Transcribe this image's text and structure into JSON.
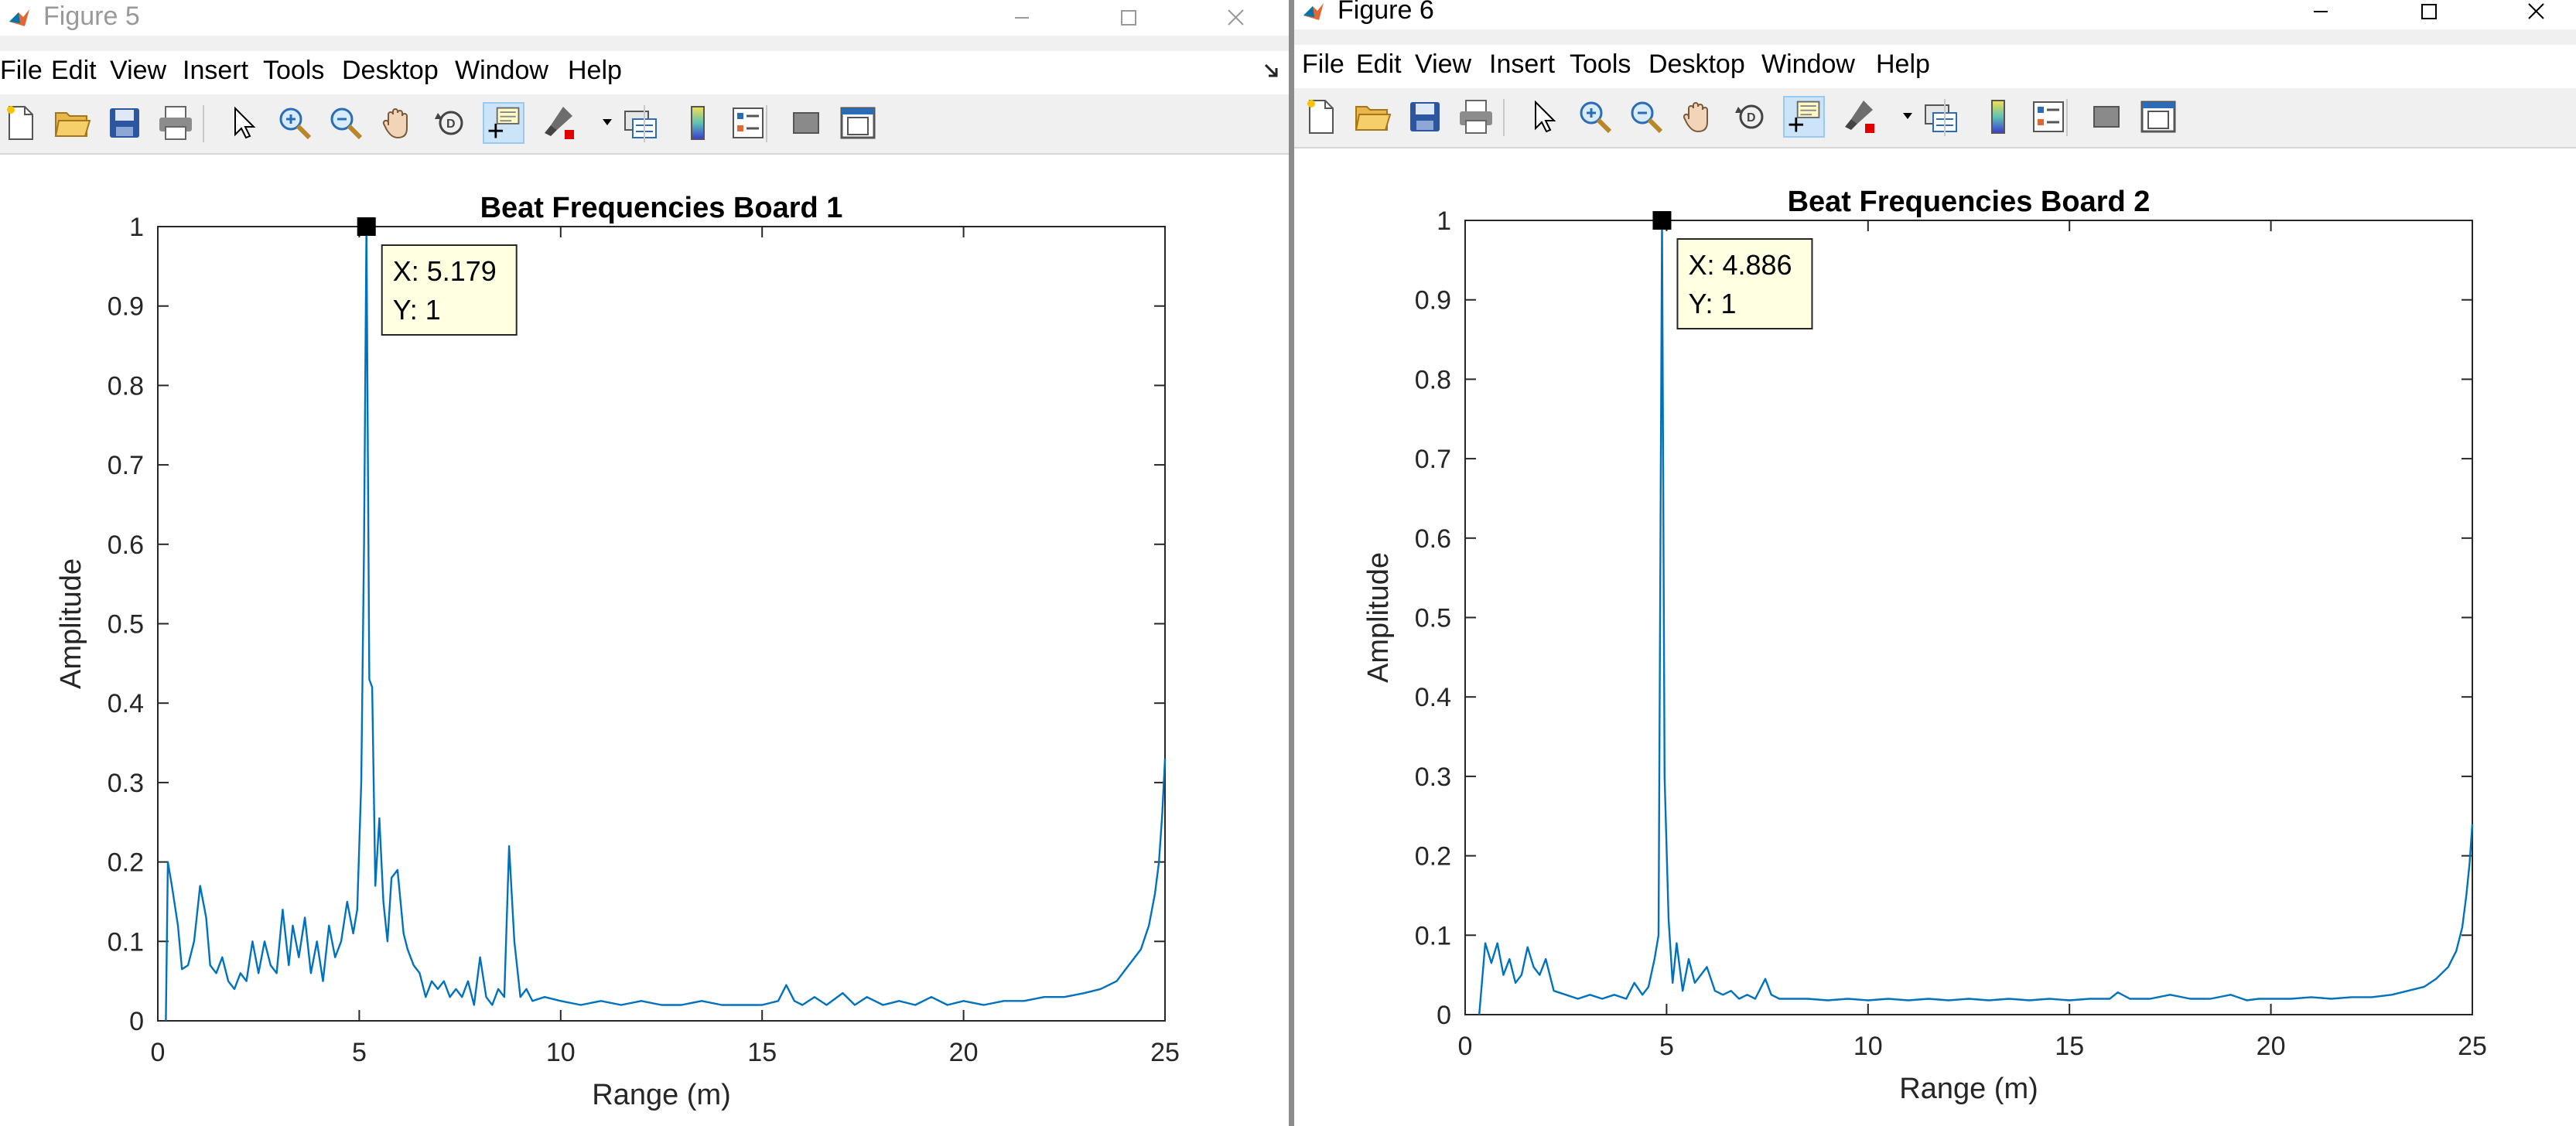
{
  "menu": [
    "File",
    "Edit",
    "View",
    "Insert",
    "Tools",
    "Desktop",
    "Window",
    "Help"
  ],
  "toolbar_icons": [
    "new-figure-icon",
    "open-file-icon",
    "save-icon",
    "print-icon",
    "edit-plot-icon",
    "zoom-in-icon",
    "zoom-out-icon",
    "pan-icon",
    "rotate-3d-icon",
    "data-cursor-icon",
    "brush-icon",
    "brush-dropdown-icon",
    "link-plot-icon",
    "colorbar-icon",
    "legend-icon",
    "hide-plot-tools-icon",
    "show-plot-tools-icon"
  ],
  "windows": [
    {
      "title": "Figure 5",
      "active": false,
      "chart_data": {
        "type": "line",
        "title": "Beat Frequencies Board 1",
        "xlabel": "Range (m)",
        "ylabel": "Amplitude",
        "xlim": [
          0,
          25
        ],
        "ylim": [
          0,
          1
        ],
        "xticks": [
          "0",
          "5",
          "10",
          "15",
          "20",
          "25"
        ],
        "yticks": [
          "0",
          "0.1",
          "0.2",
          "0.3",
          "0.4",
          "0.5",
          "0.6",
          "0.7",
          "0.8",
          "0.9",
          "1"
        ],
        "grid": false,
        "line_color": "#0072bd",
        "series": [
          {
            "x": [
              0.2,
              0.25,
              0.35,
              0.5,
              0.6,
              0.75,
              0.9,
              1.05,
              1.2,
              1.3,
              1.45,
              1.6,
              1.75,
              1.9,
              2.05,
              2.2,
              2.35,
              2.5,
              2.65,
              2.8,
              2.95,
              3.1,
              3.25,
              3.35,
              3.5,
              3.65,
              3.8,
              3.95,
              4.1,
              4.25,
              4.4,
              4.55,
              4.7,
              4.85,
              4.95,
              5.05,
              5.12,
              5.179,
              5.25,
              5.32,
              5.4,
              5.5,
              5.6,
              5.7,
              5.8,
              5.95,
              6.1,
              6.2,
              6.35,
              6.5,
              6.65,
              6.8,
              6.95,
              7.1,
              7.25,
              7.4,
              7.55,
              7.7,
              7.85,
              8.0,
              8.15,
              8.3,
              8.45,
              8.6,
              8.72,
              8.85,
              9.0,
              9.15,
              9.3,
              9.6,
              10.0,
              10.5,
              11,
              11.5,
              12,
              12.5,
              13,
              13.5,
              14,
              14.5,
              15,
              15.4,
              15.6,
              15.8,
              16,
              16.3,
              16.6,
              17,
              17.3,
              17.6,
              18,
              18.4,
              18.8,
              19.2,
              19.6,
              20,
              20.5,
              21,
              21.5,
              22,
              22.5,
              23,
              23.4,
              23.8,
              24.1,
              24.4,
              24.6,
              24.75,
              24.85,
              24.93,
              25.0
            ],
            "y": [
              0.0,
              0.2,
              0.17,
              0.12,
              0.065,
              0.07,
              0.1,
              0.17,
              0.13,
              0.07,
              0.06,
              0.08,
              0.05,
              0.04,
              0.06,
              0.05,
              0.1,
              0.06,
              0.1,
              0.07,
              0.06,
              0.14,
              0.07,
              0.12,
              0.08,
              0.13,
              0.06,
              0.1,
              0.05,
              0.12,
              0.08,
              0.1,
              0.15,
              0.11,
              0.14,
              0.3,
              0.6,
              1.0,
              0.43,
              0.42,
              0.17,
              0.255,
              0.15,
              0.1,
              0.18,
              0.19,
              0.11,
              0.09,
              0.07,
              0.06,
              0.03,
              0.05,
              0.04,
              0.05,
              0.03,
              0.04,
              0.03,
              0.05,
              0.02,
              0.08,
              0.03,
              0.02,
              0.04,
              0.03,
              0.22,
              0.1,
              0.03,
              0.04,
              0.025,
              0.03,
              0.025,
              0.02,
              0.025,
              0.02,
              0.025,
              0.02,
              0.02,
              0.025,
              0.02,
              0.02,
              0.02,
              0.025,
              0.045,
              0.025,
              0.02,
              0.03,
              0.02,
              0.035,
              0.02,
              0.03,
              0.02,
              0.025,
              0.02,
              0.03,
              0.02,
              0.025,
              0.02,
              0.025,
              0.025,
              0.03,
              0.03,
              0.035,
              0.04,
              0.05,
              0.07,
              0.09,
              0.12,
              0.16,
              0.2,
              0.26,
              0.33
            ]
          }
        ],
        "datatip": {
          "x_text": "X: 5.179",
          "y_text": "Y: 1",
          "x": 5.179,
          "y": 1
        }
      }
    },
    {
      "title": "Figure 6",
      "active": true,
      "chart_data": {
        "type": "line",
        "title": "Beat Frequencies Board 2",
        "xlabel": "Range (m)",
        "ylabel": "Amplitude",
        "xlim": [
          0,
          25
        ],
        "ylim": [
          0,
          1
        ],
        "xticks": [
          "0",
          "5",
          "10",
          "15",
          "20",
          "25"
        ],
        "yticks": [
          "0",
          "0.1",
          "0.2",
          "0.3",
          "0.4",
          "0.5",
          "0.6",
          "0.7",
          "0.8",
          "0.9",
          "1"
        ],
        "grid": false,
        "line_color": "#0072bd",
        "series": [
          {
            "x": [
              0.35,
              0.5,
              0.65,
              0.8,
              0.95,
              1.1,
              1.25,
              1.4,
              1.55,
              1.7,
              1.85,
              2.0,
              2.2,
              2.5,
              2.8,
              3.1,
              3.4,
              3.7,
              4.0,
              4.2,
              4.4,
              4.55,
              4.7,
              4.8,
              4.886,
              4.95,
              5.05,
              5.15,
              5.25,
              5.4,
              5.55,
              5.7,
              5.85,
              6.0,
              6.2,
              6.4,
              6.6,
              6.8,
              7.0,
              7.2,
              7.45,
              7.6,
              7.8,
              8.0,
              8.5,
              9,
              9.5,
              10,
              10.5,
              11,
              11.5,
              12,
              12.5,
              13,
              13.5,
              14,
              14.5,
              15,
              15.5,
              16,
              16.2,
              16.5,
              17,
              17.5,
              18,
              18.5,
              19,
              19.4,
              19.7,
              20,
              20.5,
              21,
              21.5,
              22,
              22.5,
              23,
              23.4,
              23.8,
              24.1,
              24.4,
              24.6,
              24.75,
              24.85,
              24.93,
              25.0
            ],
            "y": [
              0.0,
              0.09,
              0.065,
              0.09,
              0.05,
              0.07,
              0.04,
              0.05,
              0.085,
              0.06,
              0.05,
              0.07,
              0.03,
              0.025,
              0.02,
              0.025,
              0.02,
              0.025,
              0.02,
              0.04,
              0.025,
              0.035,
              0.07,
              0.1,
              1.0,
              0.3,
              0.12,
              0.04,
              0.09,
              0.03,
              0.07,
              0.04,
              0.05,
              0.06,
              0.03,
              0.025,
              0.03,
              0.02,
              0.025,
              0.02,
              0.045,
              0.025,
              0.02,
              0.02,
              0.02,
              0.018,
              0.02,
              0.018,
              0.02,
              0.018,
              0.02,
              0.018,
              0.02,
              0.018,
              0.02,
              0.018,
              0.02,
              0.018,
              0.02,
              0.02,
              0.028,
              0.02,
              0.02,
              0.025,
              0.02,
              0.02,
              0.025,
              0.018,
              0.02,
              0.02,
              0.02,
              0.022,
              0.02,
              0.022,
              0.022,
              0.025,
              0.03,
              0.035,
              0.045,
              0.06,
              0.08,
              0.11,
              0.15,
              0.19,
              0.24
            ]
          }
        ],
        "datatip": {
          "x_text": "X: 4.886",
          "y_text": "Y: 1",
          "x": 4.886,
          "y": 1
        }
      }
    }
  ]
}
